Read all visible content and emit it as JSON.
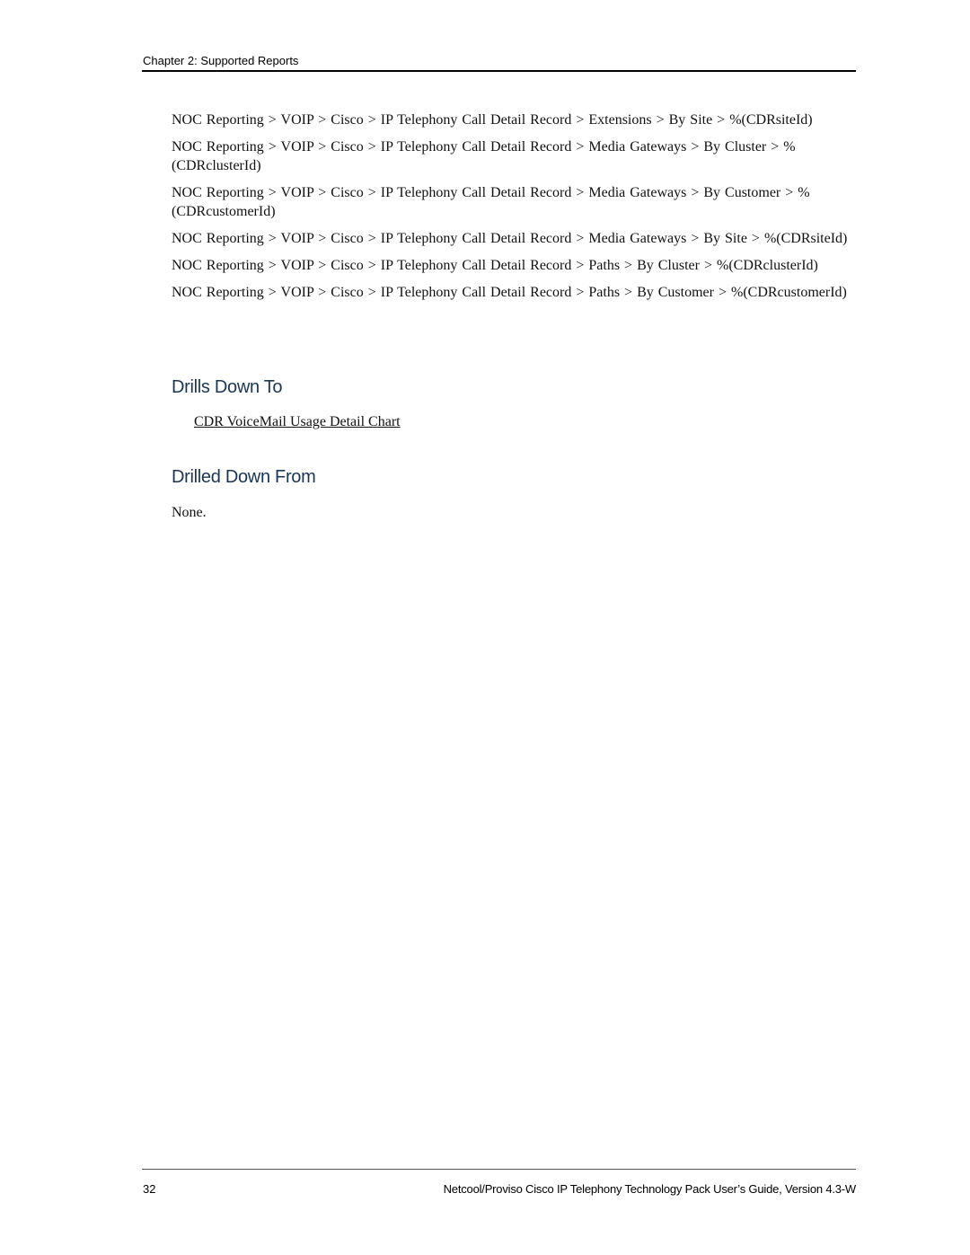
{
  "header": {
    "chapter": "Chapter 2: Supported Reports"
  },
  "paths": [
    "NOC Reporting > VOIP > Cisco > IP Telephony Call Detail Record > Extensions > By Site > %(CDRsiteId)",
    "NOC Reporting > VOIP > Cisco > IP Telephony Call Detail Record > Media Gateways > By Cluster > %(CDRclusterId)",
    "NOC Reporting > VOIP > Cisco > IP Telephony Call Detail Record > Media Gateways > By Customer > %(CDRcustomerId)",
    "NOC Reporting > VOIP > Cisco > IP Telephony Call Detail Record > Media Gateways > By Site > %(CDRsiteId)",
    "NOC Reporting > VOIP > Cisco > IP Telephony Call Detail Record > Paths > By Cluster > %(CDRclusterId)",
    "NOC Reporting > VOIP > Cisco > IP Telephony Call Detail Record > Paths > By Customer > %(CDRcustomerId)"
  ],
  "drills_down_to": {
    "heading": "Drills Down To",
    "links": [
      "CDR VoiceMail Usage Detail Chart"
    ]
  },
  "drilled_down_from": {
    "heading": "Drilled Down From",
    "text": "None."
  },
  "footer": {
    "page_number": "32",
    "title": "Netcool/Proviso Cisco IP Telephony Technology Pack User’s Guide, Version 4.3-W"
  },
  "colors": {
    "heading": "#1a3556"
  }
}
